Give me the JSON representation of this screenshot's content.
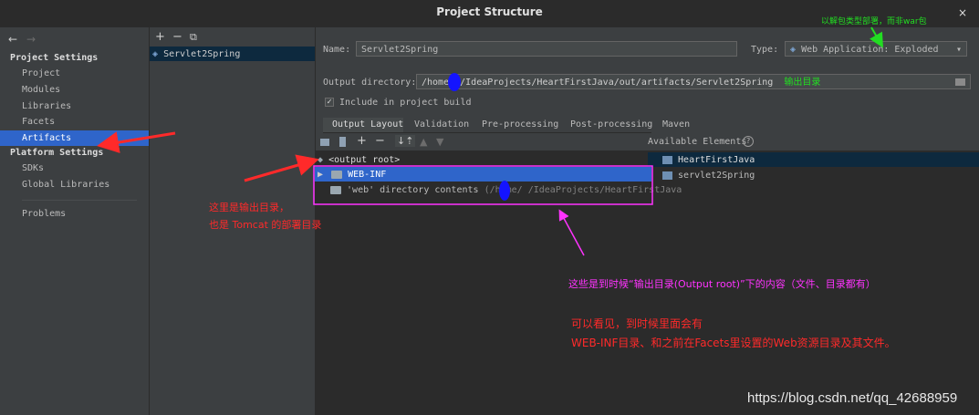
{
  "window": {
    "title": "Project Structure",
    "close": "×"
  },
  "nav": {
    "back": "←",
    "forward": "→"
  },
  "sidebar": {
    "project_settings": "Project Settings",
    "project_items": [
      "Project",
      "Modules",
      "Libraries",
      "Facets",
      "Artifacts"
    ],
    "platform_settings": "Platform Settings",
    "platform_items": [
      "SDKs",
      "Global Libraries"
    ],
    "problems": "Problems",
    "selected": "Artifacts"
  },
  "artifact_list": {
    "add": "+",
    "remove": "−",
    "copy": "⧉",
    "items": [
      "Servlet2Spring"
    ]
  },
  "form": {
    "name_label": "Name:",
    "name_value": "Servlet2Spring",
    "type_label": "Type:",
    "type_value": "Web Application: Exploded",
    "output_label": "Output directory:",
    "output_value": "/home/   /IdeaProjects/HeartFirstJava/out/artifacts/Servlet2Spring",
    "include_label": "Include in project build",
    "include_checked": true
  },
  "tabs": [
    "Output Layout",
    "Validation",
    "Pre-processing",
    "Post-processing",
    "Maven"
  ],
  "active_tab": "Output Layout",
  "available_elements": {
    "label": "Available Elements",
    "items": [
      "HeartFirstJava",
      "servlet2Spring"
    ]
  },
  "tree": {
    "root": "<output root>",
    "webinf": "WEB-INF",
    "web_contents": "'web' directory contents",
    "web_path": "(/home/   /IdeaProjects/HeartFirstJava"
  },
  "annotations": {
    "type_note": "以解包类型部署，而非war包",
    "output_note": "输出目录",
    "root_note_1": "这里是输出目录，",
    "root_note_2": "也是 Tomcat 的部署目录",
    "content_note": "这些是到时候“输出目录(Output root)”下的内容（文件、目录都有）",
    "see_note_1": "可以看见，到时候里面会有",
    "see_note_2": "WEB-INF目录、和之前在Facets里设置的Web资源目录及其文件。"
  },
  "watermark": "https://blog.csdn.net/qq_42688959",
  "colors": {
    "selection": "#2f65ca",
    "annotation_red": "#ff2a2a",
    "annotation_magenta": "#ff33ff",
    "annotation_green": "#22dd22"
  }
}
